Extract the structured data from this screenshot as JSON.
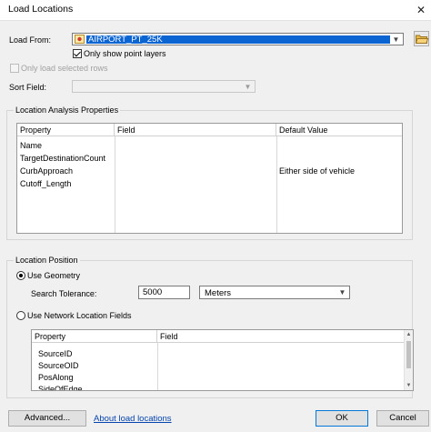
{
  "window": {
    "title": "Load Locations"
  },
  "load_from": {
    "label": "Load From:",
    "value": "AIRPORT_PT_25K",
    "only_point_layers_label": "Only show point layers",
    "only_point_layers_checked": true,
    "only_selected_rows_label": "Only load selected rows",
    "only_selected_rows_checked": false
  },
  "sort_field": {
    "label": "Sort Field:",
    "value": ""
  },
  "analysis_props": {
    "title": "Location Analysis Properties",
    "columns": [
      "Property",
      "Field",
      "Default Value"
    ],
    "rows": [
      {
        "property": "Name",
        "field": "",
        "default": ""
      },
      {
        "property": "TargetDestinationCount",
        "field": "",
        "default": ""
      },
      {
        "property": "CurbApproach",
        "field": "",
        "default": "Either side of vehicle"
      },
      {
        "property": "Cutoff_Length",
        "field": "",
        "default": ""
      }
    ]
  },
  "location_position": {
    "title": "Location Position",
    "use_geometry_label": "Use Geometry",
    "use_geometry_selected": true,
    "search_tolerance_label": "Search Tolerance:",
    "search_tolerance_value": "5000",
    "units_value": "Meters",
    "use_network_fields_label": "Use Network Location Fields",
    "network_columns": [
      "Property",
      "Field"
    ],
    "network_rows": [
      {
        "property": "SourceID",
        "field": ""
      },
      {
        "property": "SourceOID",
        "field": ""
      },
      {
        "property": "PosAlong",
        "field": ""
      },
      {
        "property": "SideOfEdge",
        "field": ""
      }
    ]
  },
  "buttons": {
    "advanced": "Advanced...",
    "about_link": "About load locations",
    "ok": "OK",
    "cancel": "Cancel"
  },
  "icons": {
    "layer": "point-layer-icon",
    "folder": "open-folder-icon",
    "close": "close-icon"
  }
}
